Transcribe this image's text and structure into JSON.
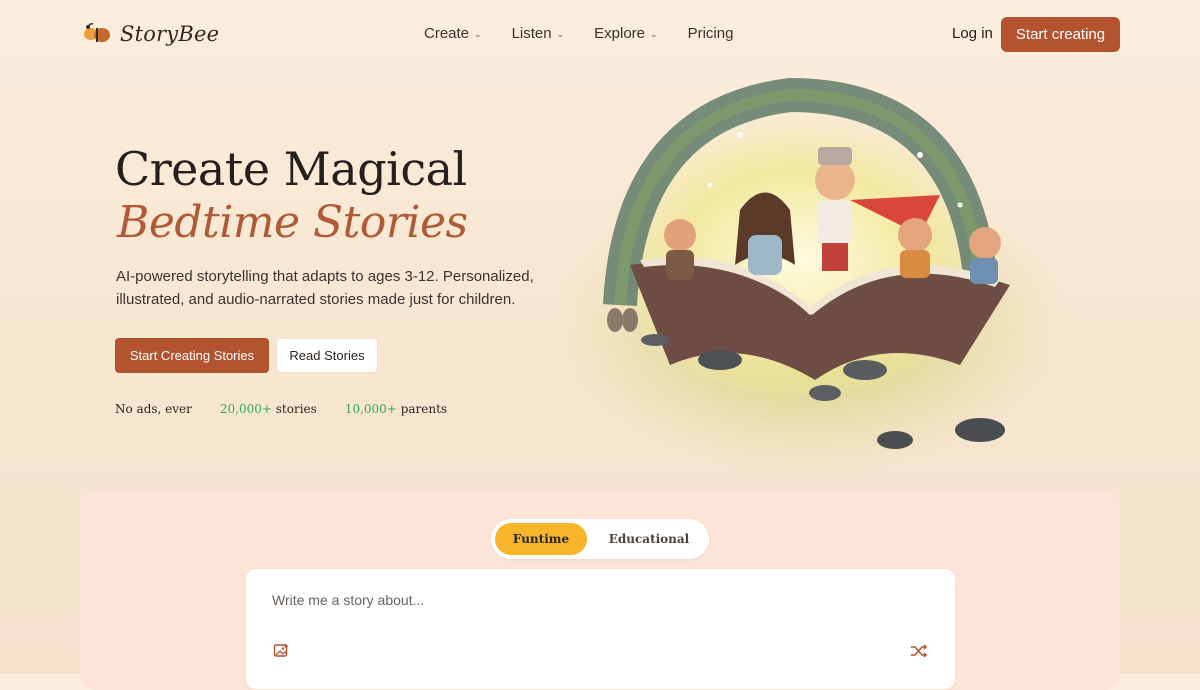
{
  "brand": {
    "name": "StoryBee",
    "logo_icon": "bee-logo-icon"
  },
  "nav": {
    "items": [
      {
        "label": "Create",
        "dropdown": true
      },
      {
        "label": "Listen",
        "dropdown": true
      },
      {
        "label": "Explore",
        "dropdown": true
      },
      {
        "label": "Pricing",
        "dropdown": false
      }
    ],
    "login_label": "Log in",
    "start_label": "Start creating"
  },
  "hero": {
    "title": "Create Magical",
    "subtitle": "Bedtime Stories",
    "description": "AI-powered storytelling that adapts to ages 3-12. Personalized, illustrated, and audio-narrated stories made just for children.",
    "primary_cta": "Start Creating Stories",
    "secondary_cta": "Read Stories",
    "stats": [
      {
        "text": "No ads, ever"
      },
      {
        "num": "20,000+",
        "text": "stories"
      },
      {
        "num": "10,000+",
        "text": "parents"
      }
    ]
  },
  "composer": {
    "tabs": [
      {
        "label": "Funtime",
        "active": true
      },
      {
        "label": "Educational",
        "active": false
      }
    ],
    "placeholder": "Write me a story about...",
    "icons": [
      "image-upload-icon",
      "shuffle-icon"
    ]
  },
  "colors": {
    "accent": "#b4532f",
    "accent_text": "#b05a35",
    "stat_green": "#2faa5a",
    "toggle_active": "#f7b52a",
    "panel_bg": "#fce4d8"
  }
}
